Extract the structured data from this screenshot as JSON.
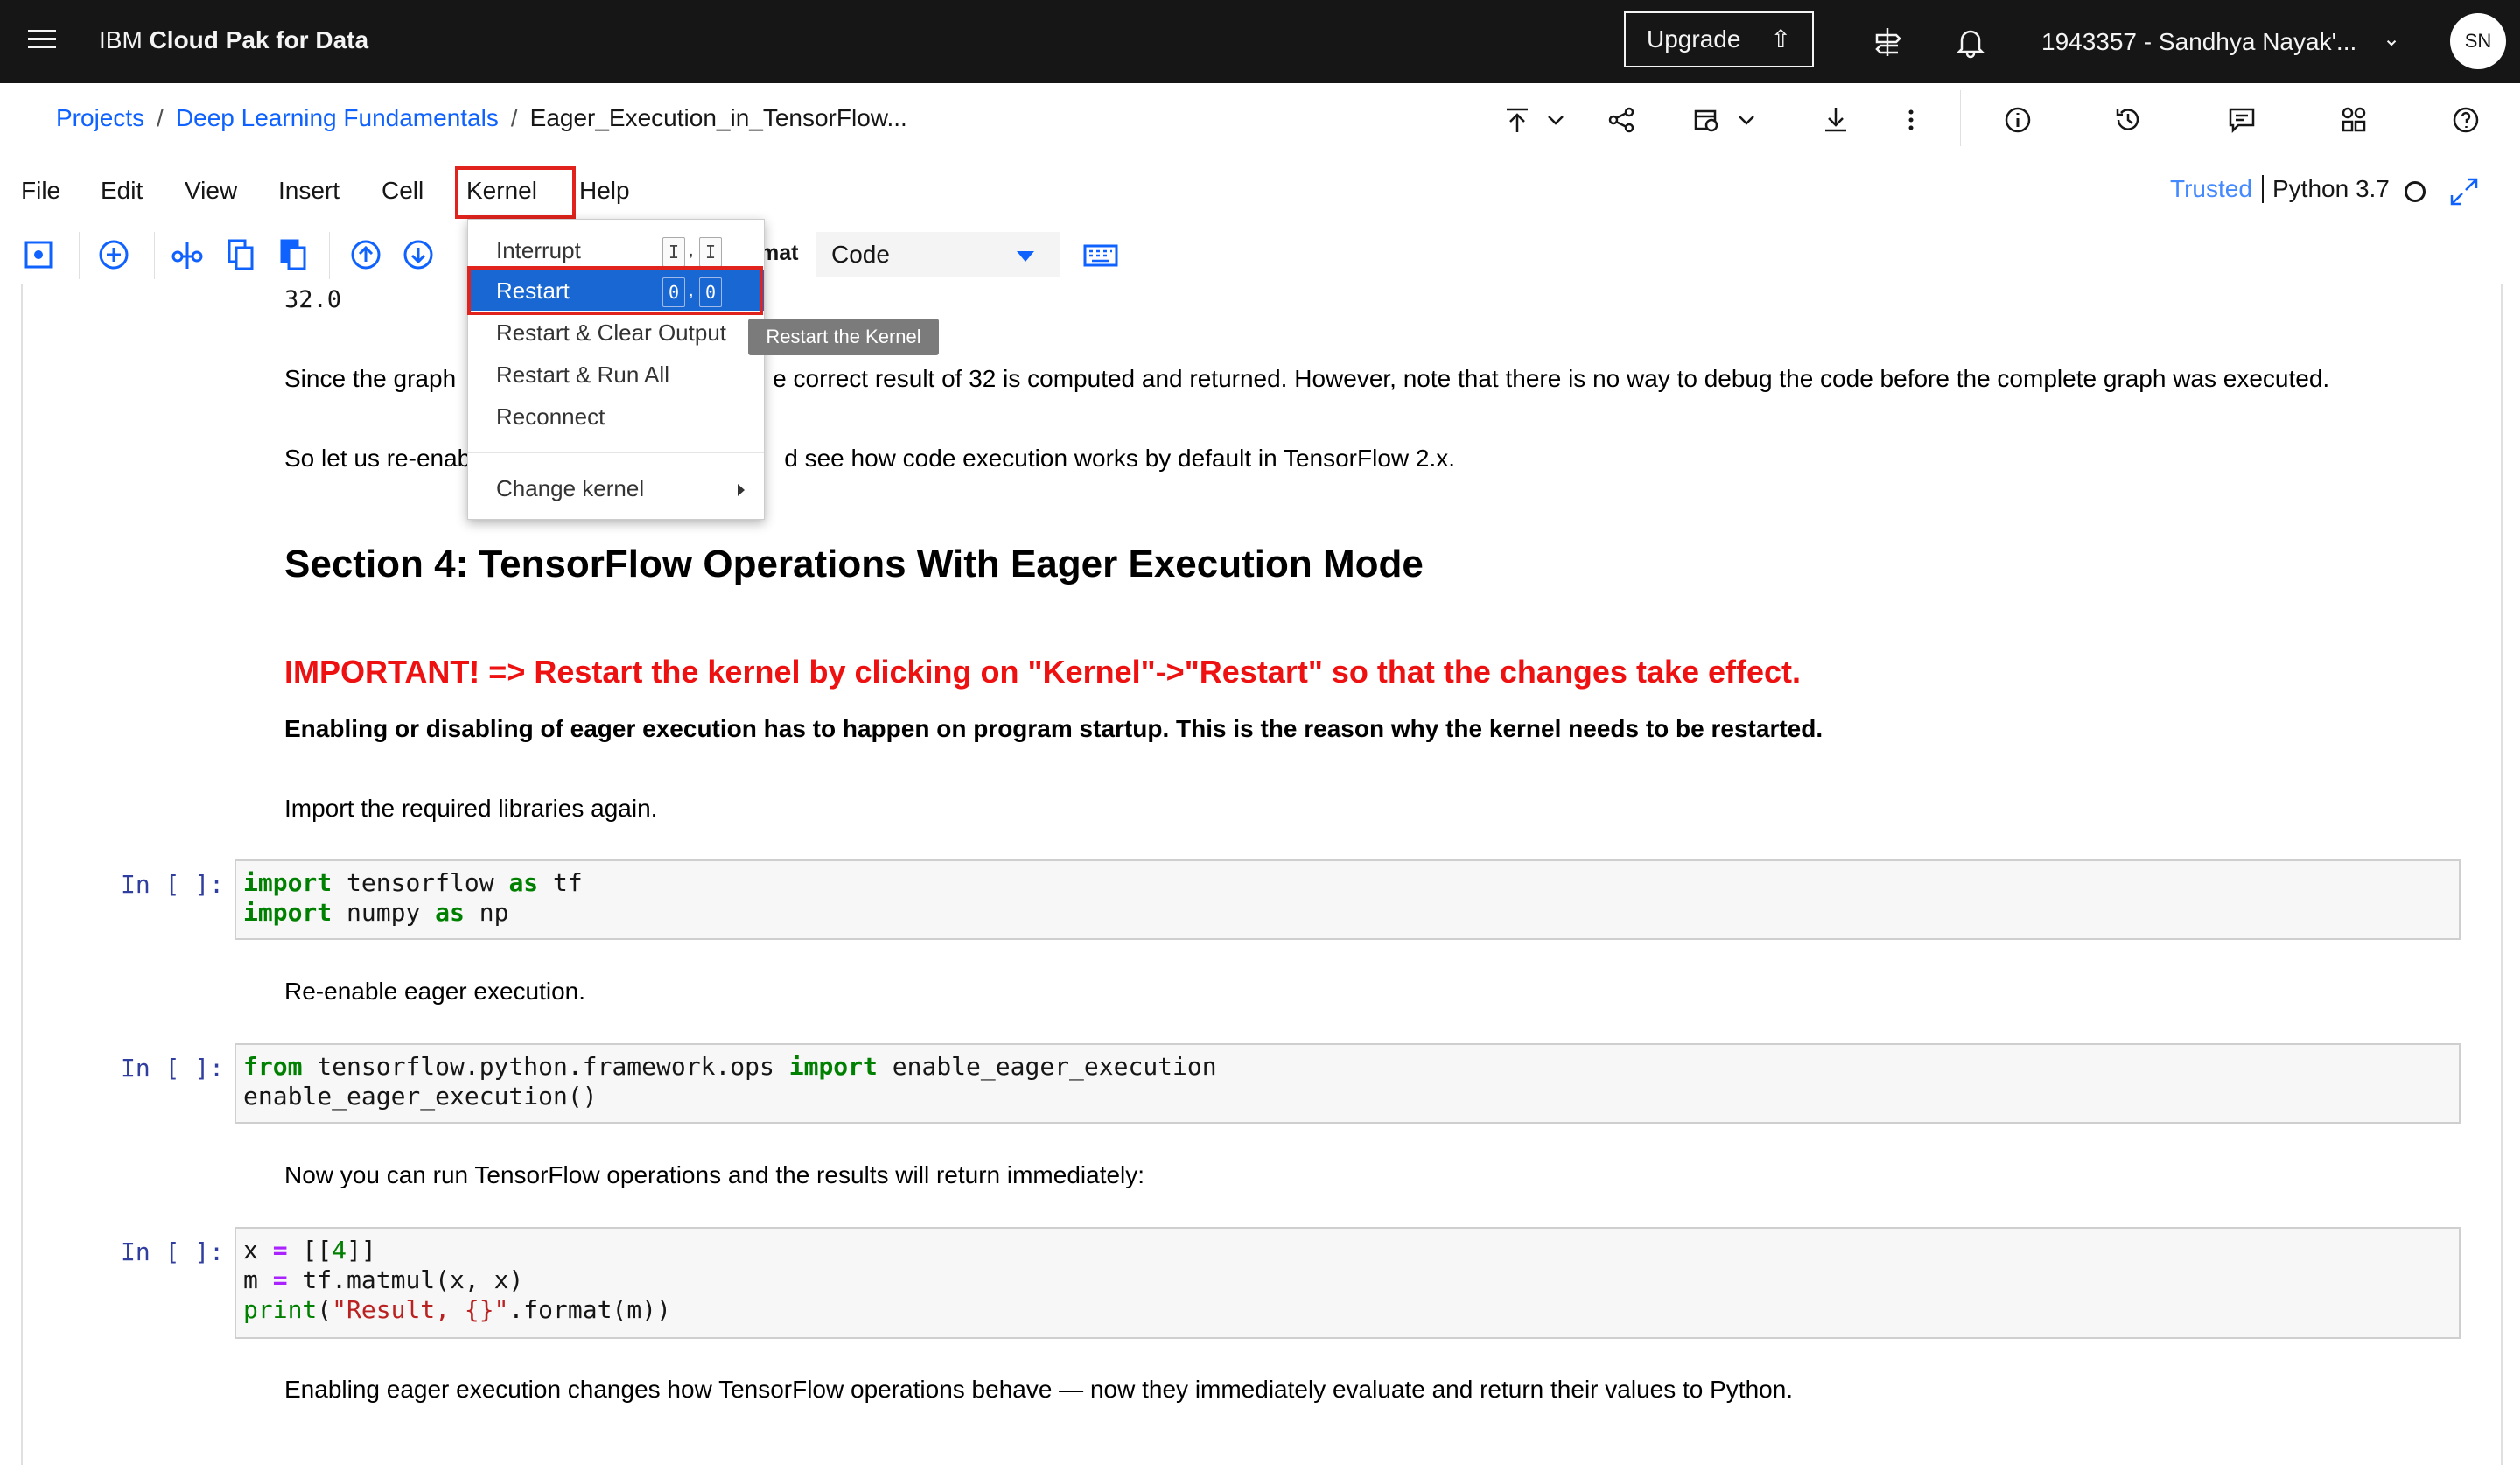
{
  "topbar": {
    "brand_prefix": "IBM",
    "brand_name": "Cloud Pak for Data",
    "upgrade_label": "Upgrade",
    "account_label": "1943357 - Sandhya Nayak'...",
    "avatar_initials": "SN"
  },
  "breadcrumb": {
    "projects": "Projects",
    "project": "Deep Learning Fundamentals",
    "notebook": "Eager_Execution_in_TensorFlow...",
    "separator": "/"
  },
  "menubar": {
    "items": [
      "File",
      "Edit",
      "View",
      "Insert",
      "Cell",
      "Kernel",
      "Help"
    ],
    "trusted": "Trusted",
    "kernel_name": "Python 3.7"
  },
  "toolbar": {
    "format_label": "mat",
    "format_value": "Code"
  },
  "kernel_menu": {
    "interrupt": {
      "label": "Interrupt",
      "key1": "I",
      "key2": "I",
      "comma": ","
    },
    "restart": {
      "label": "Restart",
      "key1": "0",
      "key2": "0",
      "comma": ","
    },
    "restart_clear": "Restart & Clear Output",
    "restart_run_all": "Restart & Run All",
    "reconnect": "Reconnect",
    "change_kernel": "Change kernel",
    "tooltip": "Restart the Kernel"
  },
  "notebook": {
    "output_value": "32.0",
    "md1": "Since the graph  e correct result of 32 is computed and returned. However, note that there is no way to debug the code before the complete graph was executed.",
    "md1_left": "Since the graph",
    "md1_right": "e correct result of 32 is computed and returned. However, note that there is no way to debug the code before the complete graph was executed.",
    "md2_left": "So let us re-enab",
    "md2_right": "d see how code execution works by default in TensorFlow 2.x.",
    "section_heading": "Section 4: TensorFlow Operations With Eager Execution Mode",
    "important": "IMPORTANT! => Restart the kernel by clicking on \"Kernel\"->\"Restart\" so that the changes take effect.",
    "important_note": "Enabling or disabling of eager execution has to happen on program startup. This is the reason why the kernel needs to be restarted.",
    "import_note": "Import the required libraries again.",
    "prompt": "In [ ]:",
    "cell1": {
      "l1_kw": "import",
      "l1_mod": " tensorflow ",
      "l1_as": "as",
      "l1_alias": " tf",
      "l2_kw": "import",
      "l2_mod": " numpy ",
      "l2_as": "as",
      "l2_alias": " np"
    },
    "reenable_note": "Re-enable eager execution.",
    "cell2": {
      "l1_from": "from",
      "l1_mod": " tensorflow.python.framework.ops ",
      "l1_import": "import",
      "l1_name": " enable_eager_execution",
      "l2": "enable_eager_execution()"
    },
    "run_note": "Now you can run TensorFlow operations and the results will return immediately:",
    "cell3": {
      "l1_a": "x ",
      "l1_eq": "=",
      "l1_b": " [[",
      "l1_num": "4",
      "l1_c": "]]",
      "l2_a": "m ",
      "l2_eq": "=",
      "l2_b": " tf.matmul(x, x)",
      "l3_print": "print",
      "l3_a": "(",
      "l3_str": "\"Result, {}\"",
      "l3_b": ".format(m))"
    },
    "final_note": "Enabling eager execution changes how TensorFlow operations behave — now they immediately evaluate and return their values to Python."
  }
}
